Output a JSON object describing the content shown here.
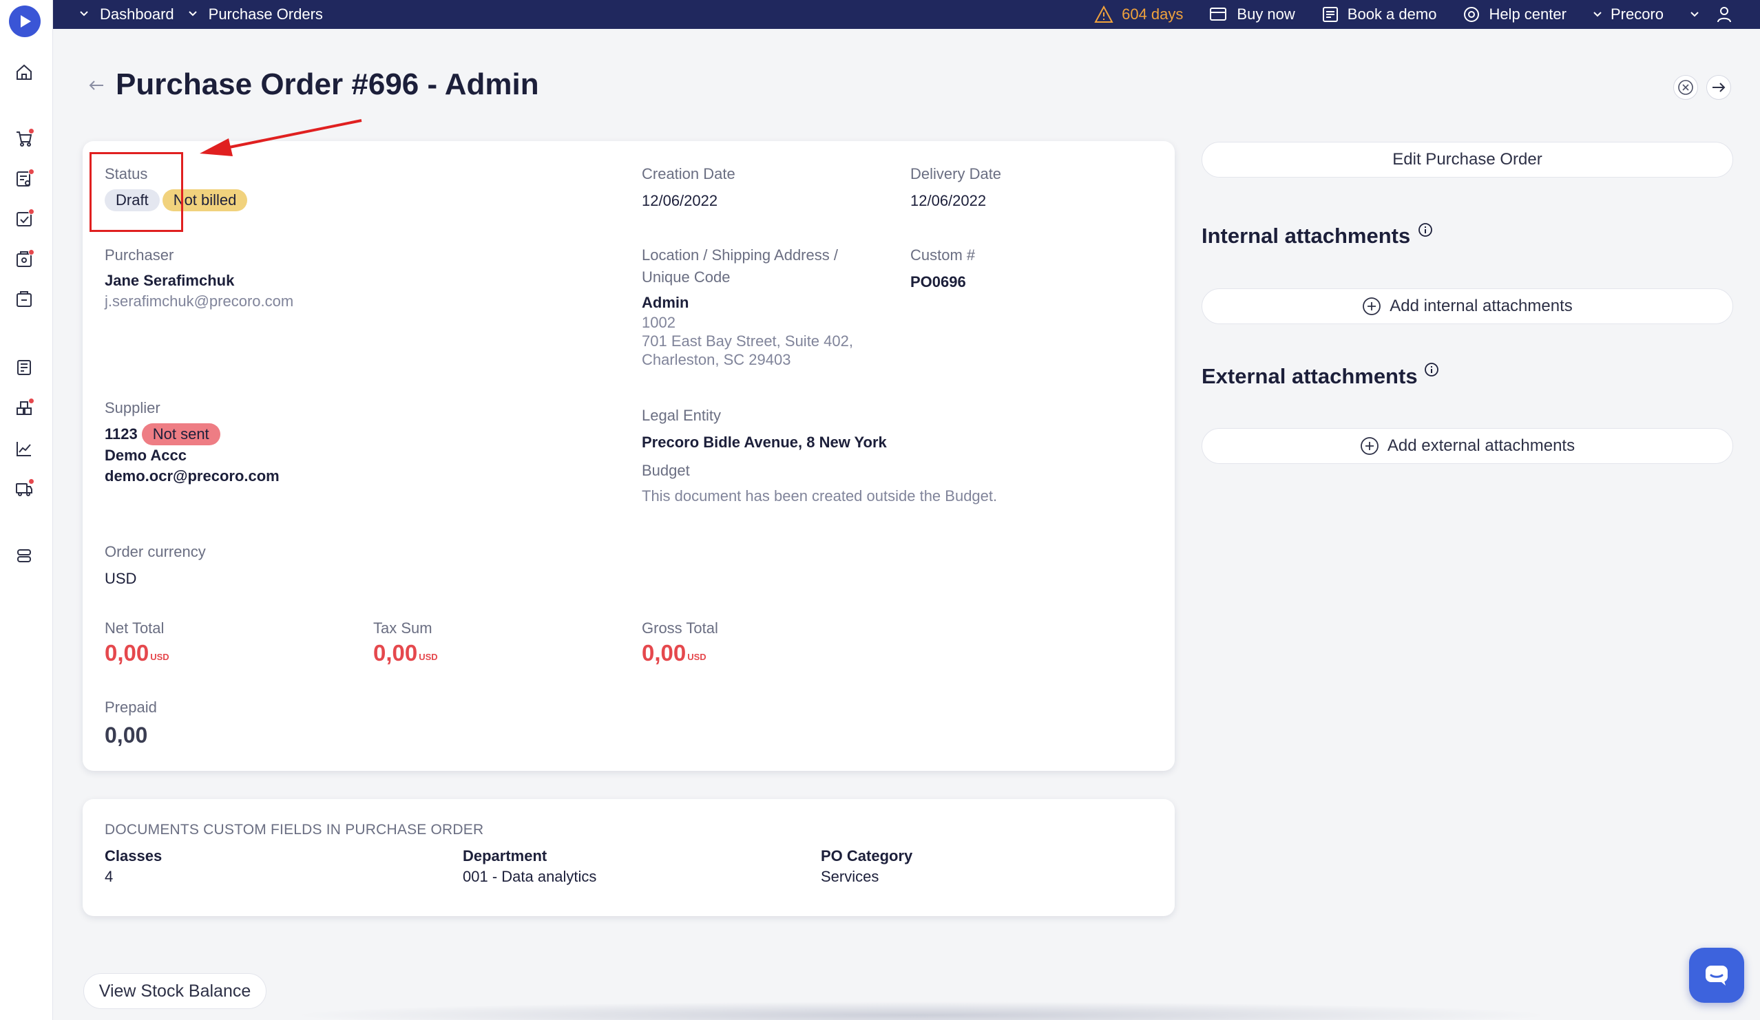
{
  "topbar": {
    "crumbs": [
      "Dashboard",
      "Purchase Orders"
    ],
    "trial_days": "604 days",
    "buy_now": "Buy now",
    "book_demo": "Book a demo",
    "help_center": "Help center",
    "company": "Precoro"
  },
  "page": {
    "title": "Purchase Order #696 - Admin"
  },
  "order": {
    "status_label": "Status",
    "status_badge": "Draft",
    "billing_badge": "Not billed",
    "creation_date_label": "Creation Date",
    "creation_date": "12/06/2022",
    "delivery_date_label": "Delivery Date",
    "delivery_date": "12/06/2022",
    "purchaser_label": "Purchaser",
    "purchaser_name": "Jane Serafimchuk",
    "purchaser_email": "j.serafimchuk@precoro.com",
    "location_label_1": "Location / Shipping Address /",
    "location_label_2": "Unique Code",
    "location_name": "Admin",
    "location_code": "1002",
    "location_address_1": "701 East Bay Street, Suite 402,",
    "location_address_2": "Charleston, SC 29403",
    "custom_no_label": "Custom #",
    "custom_no": "PO0696",
    "supplier_label": "Supplier",
    "supplier_id": "1123",
    "supplier_badge": "Not sent",
    "supplier_name": "Demo Accc",
    "supplier_email": "demo.ocr@precoro.com",
    "legal_entity_label": "Legal Entity",
    "legal_entity": "Precoro Bidle Avenue, 8 New York",
    "budget_label": "Budget",
    "budget_text": "This document has been created outside the Budget.",
    "currency_label": "Order currency",
    "currency": "USD",
    "net_total_label": "Net Total",
    "net_total": "0,00",
    "tax_sum_label": "Tax Sum",
    "tax_sum": "0,00",
    "gross_total_label": "Gross Total",
    "gross_total": "0,00",
    "currency_sup": "USD",
    "prepaid_label": "Prepaid",
    "prepaid": "0,00"
  },
  "custom_fields": {
    "title": "DOCUMENTS CUSTOM FIELDS IN PURCHASE ORDER",
    "items": [
      {
        "label": "Classes",
        "value": "4"
      },
      {
        "label": "Department",
        "value": "001 - Data analytics"
      },
      {
        "label": "PO Category",
        "value": "Services"
      }
    ]
  },
  "right_panel": {
    "edit_button": "Edit Purchase Order",
    "internal_title": "Internal attachments",
    "add_internal": "Add internal attachments",
    "external_title": "External attachments",
    "add_external": "Add external attachments"
  },
  "footer": {
    "stock_button": "View Stock Balance"
  },
  "colors": {
    "topbar": "#20285e",
    "accent": "#3a55d6",
    "danger": "#e5484d",
    "warning": "#f0a23c"
  }
}
